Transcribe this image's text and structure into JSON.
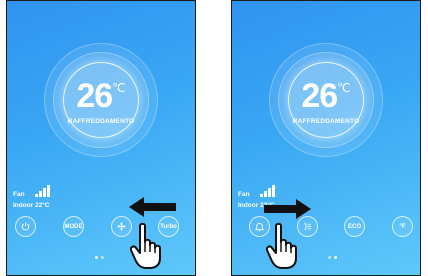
{
  "screens": [
    {
      "temperature": "26",
      "unit": "℃",
      "mode_label": "RAFFREDDAMENTO",
      "fan_label": "Fan",
      "fan_icon": "signal-bars-icon",
      "indoor_label": "Indoor 22°C",
      "buttons": [
        {
          "label": "",
          "icon": "power-icon"
        },
        {
          "label": "MODE",
          "icon": ""
        },
        {
          "label": "",
          "icon": "fan-icon"
        },
        {
          "label": "Turbo",
          "icon": ""
        }
      ],
      "page_indicator": {
        "count": 2,
        "active": 1
      },
      "gesture": {
        "direction": "left",
        "icon": "swipe-left-arrow-icon",
        "hand": "hand-pointer-icon"
      }
    },
    {
      "temperature": "26",
      "unit": "℃",
      "mode_label": "RAFFREDDAMENTO",
      "fan_label": "Fan",
      "fan_icon": "signal-bars-icon",
      "indoor_label": "Indoor 22°C",
      "buttons": [
        {
          "label": "",
          "icon": "bell-icon"
        },
        {
          "label": "",
          "icon": "airflow-icon"
        },
        {
          "label": "ECO",
          "icon": ""
        },
        {
          "label": "°F",
          "icon": ""
        }
      ],
      "page_indicator": {
        "count": 2,
        "active": 2
      },
      "gesture": {
        "direction": "right",
        "icon": "swipe-right-arrow-icon",
        "hand": "hand-pointer-icon"
      }
    }
  ],
  "colors": {
    "gradient_start": "#2f93f0",
    "gradient_end": "#5fc8fa",
    "text": "#ffffff",
    "arrow": "#111111"
  }
}
